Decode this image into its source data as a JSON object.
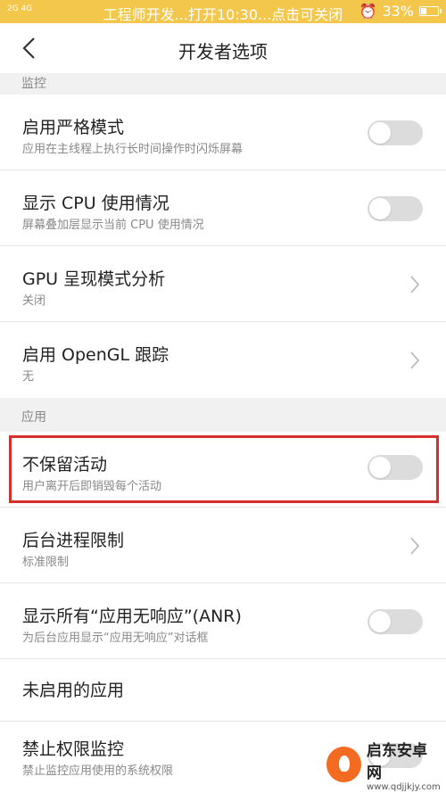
{
  "status_bar": {
    "network": "2G 4G",
    "banner": "工程师开发...打开10:30...点击可关闭",
    "battery_percent": "33%",
    "battery_level": 0.33
  },
  "header": {
    "title": "开发者选项"
  },
  "sections": [
    {
      "title": "监控",
      "items": [
        {
          "title": "启用严格模式",
          "subtitle": "应用在主线程上执行长时间操作时闪烁屏幕",
          "control": "toggle",
          "state": "off"
        },
        {
          "title": "显示 CPU 使用情况",
          "subtitle": "屏幕叠加层显示当前 CPU 使用情况",
          "control": "toggle",
          "state": "off"
        },
        {
          "title": "GPU 呈现模式分析",
          "subtitle": "关闭",
          "control": "chevron"
        },
        {
          "title": "启用 OpenGL 跟踪",
          "subtitle": "无",
          "control": "chevron"
        }
      ]
    },
    {
      "title": "应用",
      "items": [
        {
          "title": "不保留活动",
          "subtitle": "用户离开后即销毁每个活动",
          "control": "toggle",
          "state": "off",
          "highlighted": true
        },
        {
          "title": "后台进程限制",
          "subtitle": "标准限制",
          "control": "chevron"
        },
        {
          "title": "显示所有“应用无响应”(ANR)",
          "subtitle": "为后台应用显示“应用无响应”对话框",
          "control": "toggle",
          "state": "off"
        },
        {
          "title": "未启用的应用",
          "control": "none"
        },
        {
          "title": "禁止权限监控",
          "subtitle": "禁止监控应用使用的系统权限",
          "control": "toggle",
          "state": "off"
        }
      ]
    }
  ],
  "watermark": {
    "brand": "启东安卓网",
    "url": "www.qdjjkjy.com"
  },
  "colors": {
    "status_bar": "#f3c74b",
    "highlight_border": "#d62d2d",
    "toggle_off": "#dcdcdc",
    "section_bg": "#f1f1f1"
  }
}
